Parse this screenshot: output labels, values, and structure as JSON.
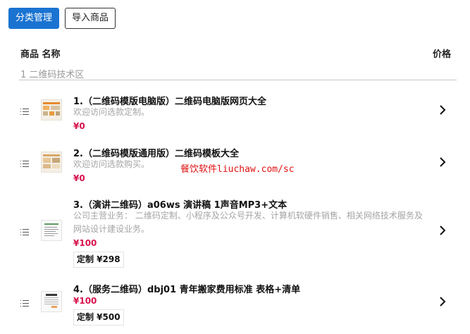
{
  "toolbar": {
    "category_button": "分类管理",
    "import_button": "导入商品"
  },
  "table": {
    "col_name": "商品 名称",
    "col_price": "价格",
    "category": "1 二维码技术区"
  },
  "products": [
    {
      "title": "1.（二维码模版电脑版）二维码电脑版网页大全",
      "desc": "欢迎访问选款定制。",
      "price": "¥0"
    },
    {
      "title": "2.（二维码模版通用版）二维码模板大全",
      "desc": "欢迎访问选款购买。",
      "price": "¥0"
    },
    {
      "title": "3.（演讲二维码）a06ws 演讲稿 1声音MP3+文本",
      "desc": "公司主营业务： 二维码定制、小程序及公众号开发、计算机软硬件销售、相关网络技术服务及网站设计建设业务。",
      "price": "¥100",
      "custom": "定制 ¥298"
    },
    {
      "title": "4.（服务二维码）dbj01 青年搬家费用标准 表格+清单",
      "price": "¥100",
      "custom": "定制 ¥500"
    }
  ],
  "watermark": "餐饮软件liuchaw.com/sc",
  "colors": {
    "primary": "#1a73d1",
    "price": "#d8144d",
    "muted": "#a5a5a5",
    "watermark": "#e01010"
  }
}
